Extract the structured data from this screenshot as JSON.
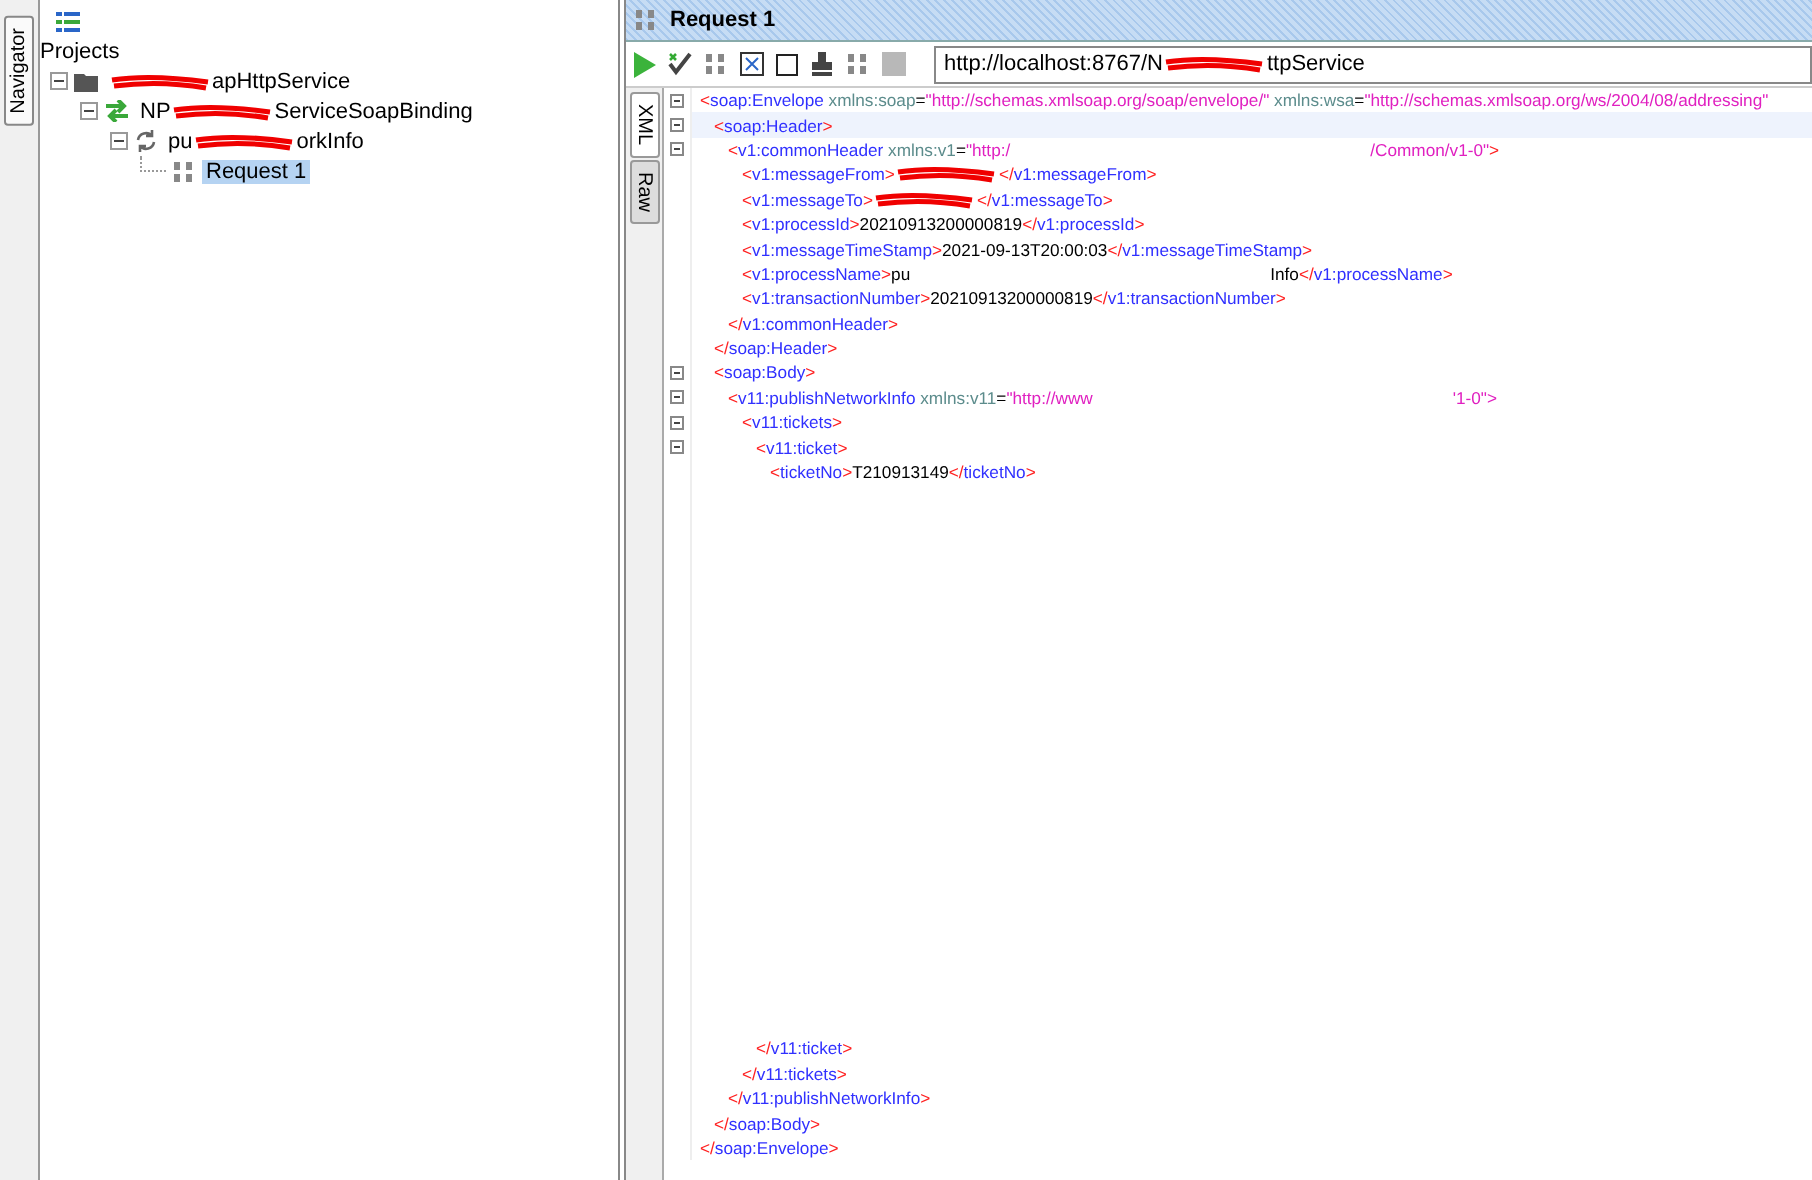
{
  "navigator": {
    "tab": "Navigator",
    "root_label": "Projects",
    "tree": [
      {
        "parts": [
          "apHttpService"
        ],
        "leading_redaction": true,
        "kind": "project",
        "expanded": true,
        "selected": false,
        "children": [
          {
            "parts": [
              "NP",
              "ServiceSoapBinding"
            ],
            "kind": "binding",
            "expanded": true,
            "selected": false,
            "children": [
              {
                "parts": [
                  "pu",
                  "orkInfo"
                ],
                "kind": "operation",
                "expanded": true,
                "selected": false,
                "children": [
                  {
                    "parts": [
                      "Request 1"
                    ],
                    "kind": "request",
                    "selected": true
                  }
                ]
              }
            ]
          }
        ]
      }
    ]
  },
  "request": {
    "title": "Request 1",
    "url_parts": [
      "http://localhost:8767/N",
      "ttpService"
    ],
    "editor_tabs": [
      {
        "label": "XML",
        "selected": true
      },
      {
        "label": "Raw",
        "selected": false
      }
    ],
    "xml": [
      {
        "kind": "element",
        "open": [
          "<soap:Envelope xmlns:soap=\"http://schemas.xmlsoap.org/soap/envelope/\" xmlns:wsa=\"http://schemas.xmlsoap.org/ws/2004/08/addressing\""
        ],
        "close": [
          "</soap:Envelope>"
        ],
        "children": [
          {
            "kind": "element",
            "open": [
              "<soap:Header>"
            ],
            "close": [
              "</soap:Header>"
            ],
            "highlight": true,
            "children": [
              {
                "kind": "element_gapped",
                "open": [
                  "<v1:commonHeader xmlns:v1=\"http:/",
                  "/Common/v1-0\">"
                ],
                "close": [
                  "</v1:commonHeader>"
                ],
                "children": [
                  {
                    "kind": "line_scribbled",
                    "line": [
                      "<v1:messageFrom>",
                      "</v1:messageFrom>"
                    ]
                  },
                  {
                    "kind": "line_scribbled",
                    "line": [
                      "<v1:messageTo>",
                      "</v1:messageTo>"
                    ]
                  },
                  {
                    "kind": "line",
                    "line": [
                      "<v1:processId>20210913200000819</v1:processId>"
                    ]
                  },
                  {
                    "kind": "line",
                    "line": [
                      "<v1:messageTimeStamp>2021-09-13T20:00:03</v1:messageTimeStamp>"
                    ]
                  },
                  {
                    "kind": "line_gapped",
                    "line": [
                      "<v1:processName>pu",
                      "Info</v1:processName>"
                    ]
                  },
                  {
                    "kind": "line",
                    "line": [
                      "<v1:transactionNumber>20210913200000819</v1:transactionNumber>"
                    ]
                  }
                ]
              }
            ]
          },
          {
            "kind": "element",
            "open": [
              "<soap:Body>"
            ],
            "close": [
              "</soap:Body>"
            ],
            "children": [
              {
                "kind": "element_gapped",
                "open": [
                  "<v11:publishNetworkInfo xmlns:v11=\"http://www",
                  "'1-0\">"
                ],
                "close": [
                  "</v11:publishNetworkInfo>"
                ],
                "children": [
                  {
                    "kind": "element",
                    "open": [
                      "<v11:tickets>"
                    ],
                    "close": [
                      "</v11:tickets>"
                    ],
                    "children": [
                      {
                        "kind": "element_spaced",
                        "open": [
                          "<v11:ticket>"
                        ],
                        "close": [
                          "</v11:ticket>"
                        ],
                        "children": [
                          {
                            "kind": "line",
                            "line": [
                              "<ticketNo>T210913149</ticketNo>"
                            ]
                          }
                        ]
                      }
                    ]
                  }
                ]
              }
            ]
          }
        ]
      }
    ]
  }
}
